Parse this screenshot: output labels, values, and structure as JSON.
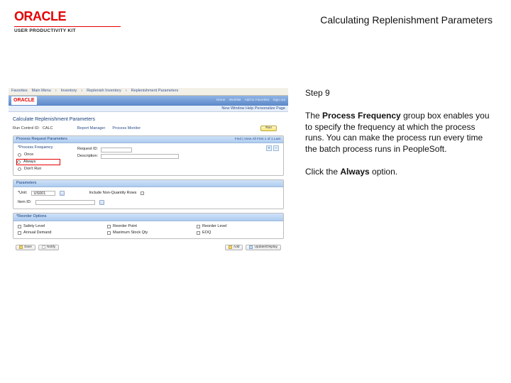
{
  "logo": {
    "brand": "ORACLE",
    "subtitle": "USER PRODUCTIVITY KIT"
  },
  "lesson_title": "Calculating Replenishment Parameters",
  "panel": {
    "step": "Step 9",
    "para_lead": "The ",
    "para_bold1": "Process Frequency",
    "para_mid": " group box enables you to specify the frequency at which the process runs. You can make the process run every time the batch process runs in PeopleSoft.",
    "click_lead": "Click the ",
    "click_bold": "Always",
    "click_tail": " option."
  },
  "app": {
    "tabs": [
      "Favorites",
      "Main Menu",
      "Inventory",
      "Replenish Inventory",
      "Replenishment Parameters"
    ],
    "top_brand": "ORACLE",
    "top_links": [
      "Home",
      "Worklist",
      "Add to Favorites",
      "Sign out"
    ],
    "subbar": "New Window  Help  Personalize Page",
    "page_title": "Calculate Replenishment Parameters",
    "run_id_lbl": "Run Control ID:",
    "run_id_val": "CALC",
    "report_lbl": "Report Manager",
    "process_lbl": "Process Monitor",
    "run_btn": "Run",
    "req_group": {
      "title": "Process Request Parameters",
      "pager": "Find | View All   First  1 of 1  Last",
      "freq_title": "*Process Frequency",
      "freq_opts": [
        "Once",
        "Always",
        "Don't Run"
      ],
      "request_id_lbl": "Request ID:",
      "desc_lbl": "Description:"
    },
    "params_group": {
      "title": "Parameters",
      "unit_lbl": "*Unit:",
      "unit_val": "US001",
      "incl_lbl": "Include Non-Quantity Rows"
    },
    "reorder_group": {
      "title": "*Reorder Options",
      "items": [
        "Safety Level",
        "Reorder Point",
        "Reorder Level",
        "Annual Demand",
        "Maximum Stock Qty",
        "EOQ"
      ]
    },
    "bottom": {
      "save": "Save",
      "notify": "Notify",
      "add": "Add",
      "update": "Update/Display"
    }
  }
}
